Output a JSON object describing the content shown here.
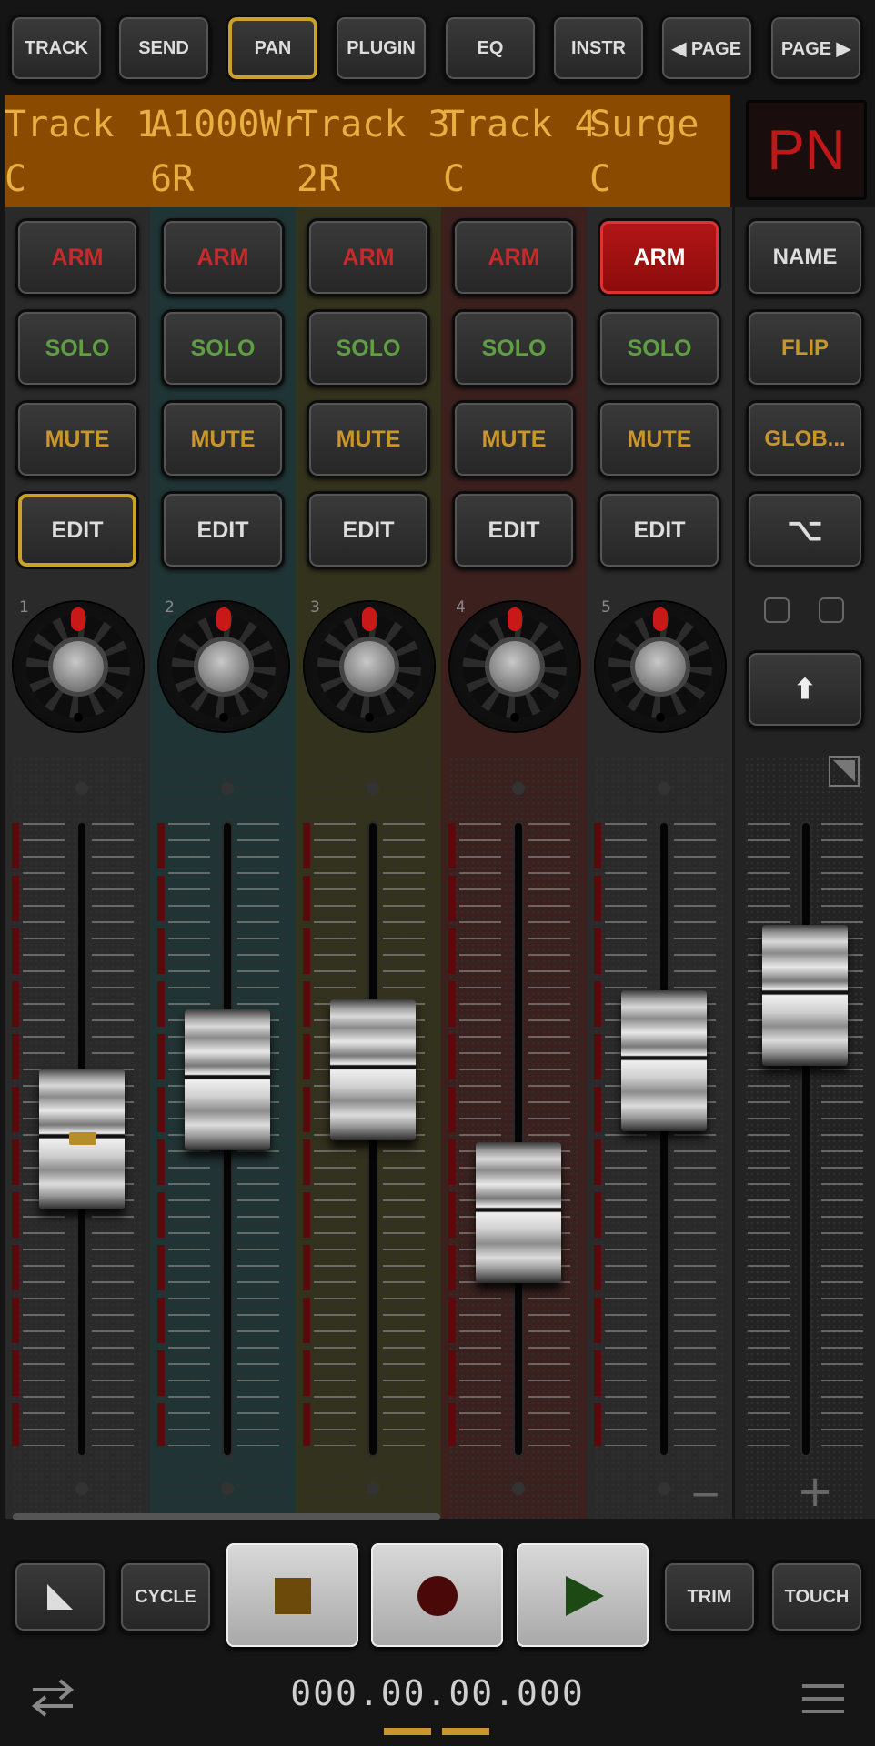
{
  "top_bar": {
    "buttons": [
      "TRACK",
      "SEND",
      "PAN",
      "PLUGIN",
      "EQ",
      "INSTR",
      "◀ PAGE",
      "PAGE ▶"
    ],
    "active": "PAN"
  },
  "lcd": {
    "names": [
      "Track 1",
      "A1000Wr",
      "Track 3",
      "Track 4",
      "Surge"
    ],
    "pans": [
      "C",
      "6R",
      "2R",
      "C",
      "C"
    ]
  },
  "mode_display": "PN",
  "channels": [
    {
      "number": "1",
      "arm": "ARM",
      "solo": "SOLO",
      "mute": "MUTE",
      "edit": "EDIT",
      "arm_on": false,
      "edit_on": true,
      "fader_level": 0.5,
      "tint": "#2a2a2a"
    },
    {
      "number": "2",
      "arm": "ARM",
      "solo": "SOLO",
      "mute": "MUTE",
      "edit": "EDIT",
      "arm_on": false,
      "edit_on": false,
      "fader_level": 0.62,
      "tint": "#1f3434"
    },
    {
      "number": "3",
      "arm": "ARM",
      "solo": "SOLO",
      "mute": "MUTE",
      "edit": "EDIT",
      "arm_on": false,
      "edit_on": false,
      "fader_level": 0.64,
      "tint": "#33321c"
    },
    {
      "number": "4",
      "arm": "ARM",
      "solo": "SOLO",
      "mute": "MUTE",
      "edit": "EDIT",
      "arm_on": false,
      "edit_on": false,
      "fader_level": 0.35,
      "tint": "#3b201e"
    },
    {
      "number": "5",
      "arm": "ARM",
      "solo": "SOLO",
      "mute": "MUTE",
      "edit": "EDIT",
      "arm_on": true,
      "edit_on": false,
      "fader_level": 0.66,
      "tint": "#2a2a2a"
    }
  ],
  "side_panel": {
    "name": "NAME",
    "flip": "FLIP",
    "global": "GLOB...",
    "option_glyph": "⌥",
    "shift_glyph": "⬆",
    "master_fader_level": 0.7,
    "minus": "−",
    "plus": "+"
  },
  "transport": {
    "cycle": "CYCLE",
    "trim": "TRIM",
    "touch": "TOUCH"
  },
  "counter": "000.00.00.000",
  "colors": {
    "accent_gold": "#c9a227",
    "arm_red": "#c42b2b",
    "solo_green": "#5f9e44",
    "mute_amber": "#c9962b",
    "lcd_bg": "#8a4a00",
    "lcd_text": "#e7b040"
  },
  "icons": [
    "pointer-icon",
    "stop-icon",
    "record-icon",
    "play-icon",
    "swap-arrows-icon",
    "hamburger-menu-icon",
    "resize-corner-icon"
  ]
}
